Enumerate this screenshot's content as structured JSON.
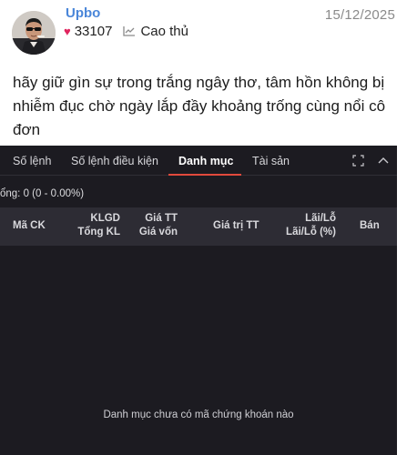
{
  "post": {
    "username": "Upbo",
    "likes": "33107",
    "rank": "Cao thủ",
    "date": "15/12/2025",
    "text": "hãy giữ gìn sự trong trắng ngây thơ, tâm hồn không bị nhiễm đục chờ ngày lắp đầy khoảng trống cùng nổi cô đơn"
  },
  "panel": {
    "tabs": [
      {
        "label": "Số lệnh",
        "active": false
      },
      {
        "label": "Số lệnh điều kiện",
        "active": false
      },
      {
        "label": "Danh mục",
        "active": true
      },
      {
        "label": "Tài sản",
        "active": false
      }
    ],
    "total_line": "ổng:  0  (0  -  0.00%)",
    "columns": {
      "ma_ck": "Mã CK",
      "klgd": "KLGD",
      "tong_kl": "Tổng KL",
      "gia_tt": "Giá TT",
      "gia_von": "Giá vốn",
      "gia_tri_tt": "Giá trị TT",
      "lai_lo": "Lãi/Lỗ",
      "lai_lo_pct": "Lãi/Lỗ (%)",
      "ban": "Bán"
    },
    "empty_message": "Danh mục chưa có mã chứng khoán nào",
    "icons": [
      "expand-icon",
      "chevron-up-icon"
    ]
  },
  "colors": {
    "username": "#4a86d9",
    "heart": "#e0245e",
    "panel_bg": "#1c1b21",
    "header_bg": "#2d2c34",
    "active_tab_underline": "#e14a3c"
  }
}
